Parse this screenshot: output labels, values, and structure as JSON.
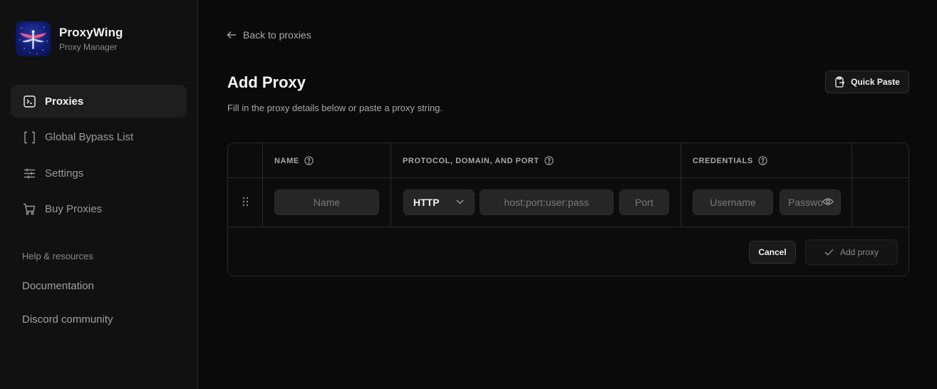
{
  "brand": {
    "name": "ProxyWing",
    "subtitle": "Proxy Manager"
  },
  "sidebar": {
    "items": [
      {
        "label": "Proxies",
        "icon": "terminal-icon",
        "active": true
      },
      {
        "label": "Global Bypass List",
        "icon": "brackets-icon",
        "active": false
      },
      {
        "label": "Settings",
        "icon": "sliders-icon",
        "active": false
      },
      {
        "label": "Buy Proxies",
        "icon": "cart-icon",
        "active": false
      }
    ],
    "help_title": "Help & resources",
    "help_links": [
      "Documentation",
      "Discord community"
    ]
  },
  "main": {
    "back_label": "Back to proxies",
    "title": "Add Proxy",
    "subtitle": "Fill in the proxy details below or paste a proxy string.",
    "quick_paste_label": "Quick Paste",
    "table": {
      "headers": [
        "NAME",
        "PROTOCOL, DOMAIN, AND PORT",
        "CREDENTIALS"
      ],
      "row": {
        "name_placeholder": "Name",
        "protocol": "HTTP",
        "host_placeholder": "host:port:user:pass",
        "port_placeholder": "Port",
        "username_placeholder": "Username",
        "password_placeholder": "Password"
      }
    },
    "cancel_label": "Cancel",
    "add_label": "Add proxy"
  }
}
